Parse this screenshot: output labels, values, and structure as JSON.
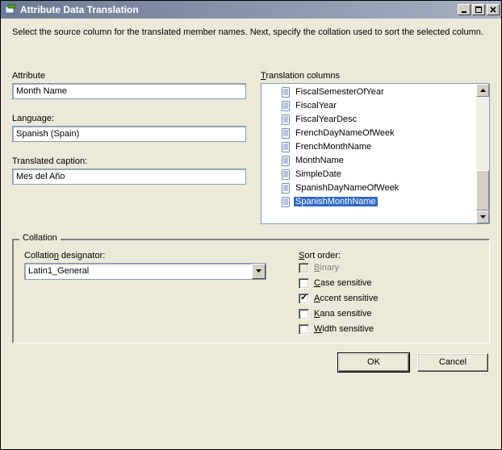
{
  "window": {
    "title": "Attribute Data Translation"
  },
  "instructions": "Select the source column for the translated member names.  Next, specify the collation used to sort the selected column.",
  "labels": {
    "attribute": "Attribute",
    "language": "Language:",
    "translated_caption": "Translated caption:",
    "translation_columns": "Translation columns",
    "collation_group": "Collation",
    "collation_designator": "Collation designator:",
    "sort_order": "Sort order:"
  },
  "fields": {
    "attribute": "Month Name",
    "language": "Spanish (Spain)",
    "translated_caption": "Mes del Año",
    "collation_designator": "Latin1_General"
  },
  "columns": [
    {
      "name": "FiscalSemesterOfYear",
      "selected": false
    },
    {
      "name": "FiscalYear",
      "selected": false
    },
    {
      "name": "FiscalYearDesc",
      "selected": false
    },
    {
      "name": "FrenchDayNameOfWeek",
      "selected": false
    },
    {
      "name": "FrenchMonthName",
      "selected": false
    },
    {
      "name": "MonthName",
      "selected": false
    },
    {
      "name": "SimpleDate",
      "selected": false
    },
    {
      "name": "SpanishDayNameOfWeek",
      "selected": false
    },
    {
      "name": "SpanishMonthName",
      "selected": true
    }
  ],
  "sort_order": {
    "binary": {
      "label": "Binary",
      "checked": false,
      "enabled": false
    },
    "case_sensitive": {
      "label": "Case sensitive",
      "checked": false,
      "enabled": true
    },
    "accent_sensitive": {
      "label": "Accent sensitive",
      "checked": true,
      "enabled": true
    },
    "kana_sensitive": {
      "label": "Kana sensitive",
      "checked": false,
      "enabled": true
    },
    "width_sensitive": {
      "label": "Width sensitive",
      "checked": false,
      "enabled": true
    }
  },
  "buttons": {
    "ok": "OK",
    "cancel": "Cancel"
  }
}
